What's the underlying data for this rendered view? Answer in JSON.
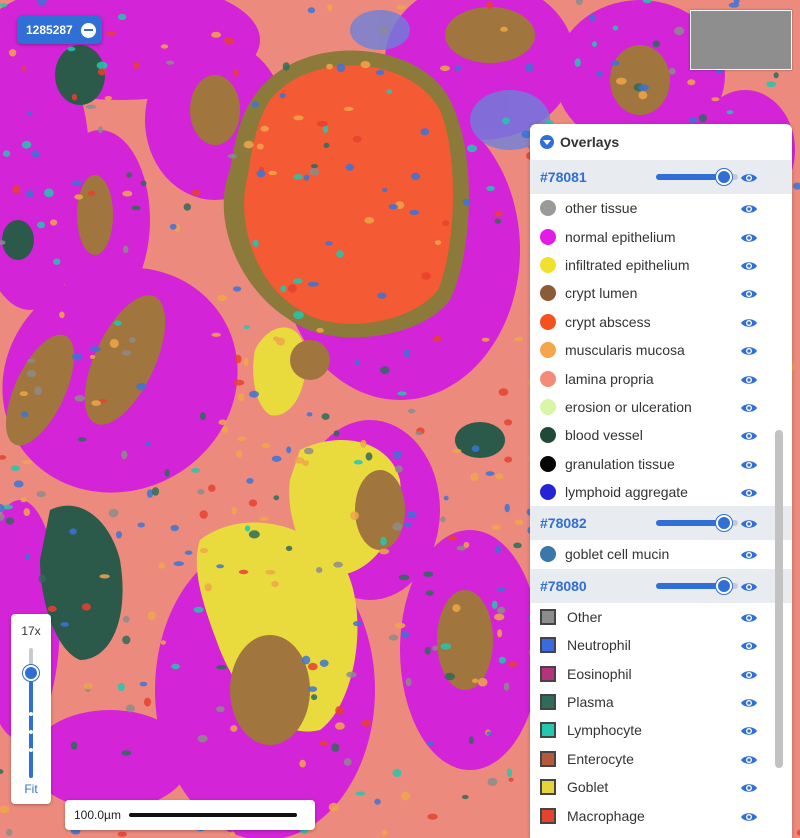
{
  "slide": {
    "id": "1285287"
  },
  "overlays": {
    "title": "Overlays",
    "groups": [
      {
        "id": "#78081",
        "opacity": 0.8,
        "items": [
          {
            "label": "other tissue",
            "color": "#9a9a9a",
            "shape": "dot"
          },
          {
            "label": "normal epithelium",
            "color": "#e21be6",
            "shape": "dot"
          },
          {
            "label": "infiltrated epithelium",
            "color": "#f2e12c",
            "shape": "dot"
          },
          {
            "label": "crypt lumen",
            "color": "#8b5a36",
            "shape": "dot"
          },
          {
            "label": "crypt abscess",
            "color": "#f4511e",
            "shape": "dot"
          },
          {
            "label": "muscularis mucosa",
            "color": "#f5a54a",
            "shape": "dot"
          },
          {
            "label": "lamina propria",
            "color": "#f38b78",
            "shape": "dot"
          },
          {
            "label": "erosion or ulceration",
            "color": "#d9f5a6",
            "shape": "dot"
          },
          {
            "label": "blood vessel",
            "color": "#1f4a3a",
            "shape": "dot"
          },
          {
            "label": "granulation tissue",
            "color": "#060606",
            "shape": "dot"
          },
          {
            "label": "lymphoid aggregate",
            "color": "#2424d6",
            "shape": "dot"
          }
        ]
      },
      {
        "id": "#78082",
        "opacity": 0.8,
        "items": [
          {
            "label": "goblet cell mucin",
            "color": "#3b77a9",
            "shape": "dot"
          }
        ]
      },
      {
        "id": "#78080",
        "opacity": 0.8,
        "items": [
          {
            "label": "Other",
            "color": "#8c8c8c",
            "shape": "box"
          },
          {
            "label": "Neutrophil",
            "color": "#3a6ae0",
            "shape": "box"
          },
          {
            "label": "Eosinophil",
            "color": "#b5337a",
            "shape": "box"
          },
          {
            "label": "Plasma",
            "color": "#2f6b5a",
            "shape": "box"
          },
          {
            "label": "Lymphocyte",
            "color": "#25c7ae",
            "shape": "box"
          },
          {
            "label": "Enterocyte",
            "color": "#b35a3c",
            "shape": "box"
          },
          {
            "label": "Goblet",
            "color": "#e6d23a",
            "shape": "box"
          },
          {
            "label": "Macrophage",
            "color": "#e8412e",
            "shape": "box"
          }
        ]
      }
    ]
  },
  "zoom": {
    "level": "17x",
    "fit_label": "Fit",
    "fraction": 0.82
  },
  "scale": {
    "label": "100.0µm"
  }
}
